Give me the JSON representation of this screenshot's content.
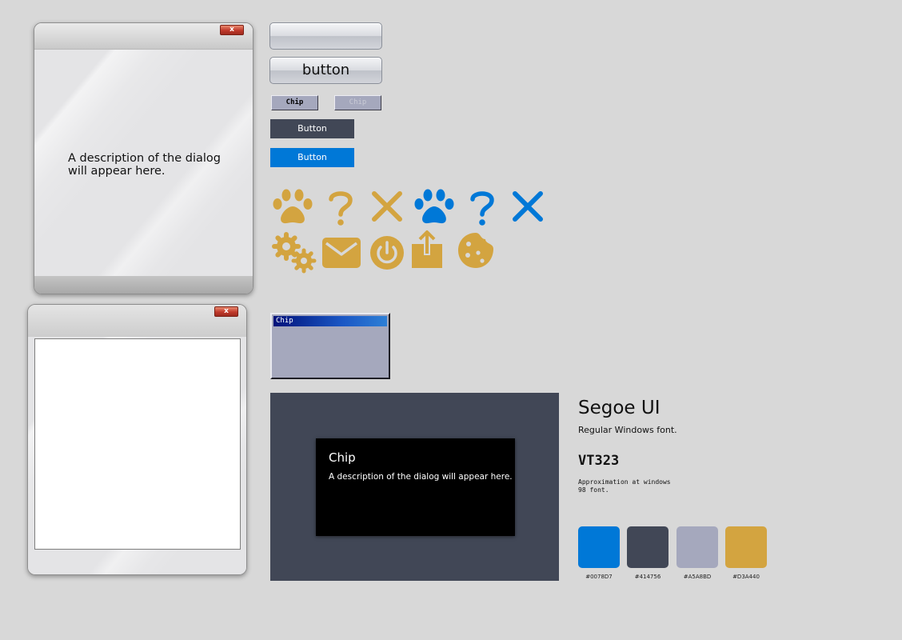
{
  "aero_dialog": {
    "close_label": "x",
    "description": "A description of the dialog will appear here."
  },
  "aero_window": {
    "close_label": "x"
  },
  "aero_buttons": {
    "empty_label": "",
    "button_label": "button"
  },
  "w98_chips": {
    "enabled_label": "Chip",
    "disabled_label": "Chip"
  },
  "flat_buttons": {
    "dark_label": "Button",
    "blue_label": "Button"
  },
  "icons": {
    "row1": [
      "paw-icon",
      "question-icon",
      "close-icon",
      "paw-icon",
      "question-icon",
      "close-icon"
    ],
    "row2": [
      "gear-icon",
      "mail-icon",
      "power-icon",
      "share-icon",
      "cookie-icon"
    ]
  },
  "w98_window": {
    "title": "Chip"
  },
  "dark_panel": {
    "dialog_title": "Chip",
    "dialog_description": "A description of the dialog will appear here."
  },
  "typography": {
    "segoe_title": "Segoe UI",
    "segoe_desc": "Regular Windows font.",
    "vt_title": "VT323",
    "vt_desc_line1": "Approximation at windows",
    "vt_desc_line2": "98 font."
  },
  "palette": [
    {
      "hex": "#0078D7",
      "label": "#0078D7"
    },
    {
      "hex": "#414756",
      "label": "#414756"
    },
    {
      "hex": "#A5A8BD",
      "label": "#A5A8BD"
    },
    {
      "hex": "#D3A440",
      "label": "#D3A440"
    }
  ]
}
